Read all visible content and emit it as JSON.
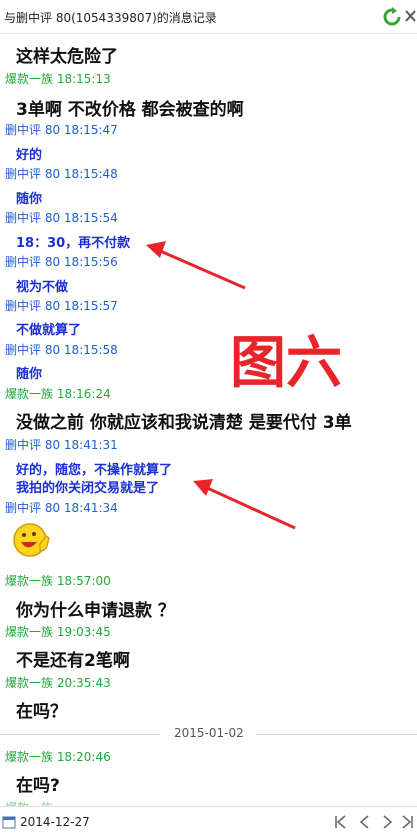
{
  "window": {
    "title": "与删中评 80(1054339807)的消息记录"
  },
  "messages": [
    {
      "type": "text",
      "body": "这样太危险了"
    },
    {
      "type": "header",
      "sender": "爆款一族",
      "time": "18:15:13"
    },
    {
      "type": "text",
      "body": "3单啊  不改价格 都会被查的啊"
    },
    {
      "type": "header",
      "sender": "删中评 80",
      "time": "18:15:47"
    },
    {
      "type": "text",
      "body": "好的"
    },
    {
      "type": "header",
      "sender": "删中评 80",
      "time": "18:15:48"
    },
    {
      "type": "text",
      "body": "随你"
    },
    {
      "type": "header",
      "sender": "删中评 80",
      "time": "18:15:54"
    },
    {
      "type": "text",
      "body": "18：30，再不付款"
    },
    {
      "type": "header",
      "sender": "删中评 80",
      "time": "18:15:56"
    },
    {
      "type": "text",
      "body": "视为不做"
    },
    {
      "type": "header",
      "sender": "删中评 80",
      "time": "18:15:57"
    },
    {
      "type": "text",
      "body": "不做就算了"
    },
    {
      "type": "header",
      "sender": "删中评 80",
      "time": "18:15:58"
    },
    {
      "type": "text",
      "body": "随你"
    },
    {
      "type": "header",
      "sender": "爆款一族",
      "time": "18:16:24"
    },
    {
      "type": "text",
      "body": "没做之前 你就应该和我说清楚  是要代付  3单"
    },
    {
      "type": "header",
      "sender": "删中评 80",
      "time": "18:41:31"
    },
    {
      "type": "text",
      "body": "好的，随您，不操作就算了"
    },
    {
      "type": "text",
      "body": "我拍的你关闭交易就是了"
    },
    {
      "type": "header",
      "sender": "删中评 80",
      "time": "18:41:34"
    },
    {
      "type": "emoji",
      "icon": "thumbs-up-smiley-emoji"
    },
    {
      "type": "header",
      "sender": "爆款一族",
      "time": "18:57:00"
    },
    {
      "type": "text",
      "body": "你为什么申请退款  ？"
    },
    {
      "type": "header",
      "sender": "爆款一族",
      "time": "19:03:45"
    },
    {
      "type": "text",
      "body": "不是还有2笔啊"
    },
    {
      "type": "header",
      "sender": "爆款一族",
      "time": "20:35:43"
    },
    {
      "type": "text",
      "body": "在吗？"
    },
    {
      "type": "date",
      "label": "2015-01-02"
    },
    {
      "type": "header",
      "sender": "爆款一族",
      "time": "18:20:46"
    },
    {
      "type": "text",
      "body": "在吗?"
    }
  ],
  "watermark": {
    "text": "图六",
    "color": "#e8252b"
  },
  "colors": {
    "buyer": "#21a83b",
    "seller": "#1f5fd1",
    "seller_text": "#1a2fd6",
    "arrow": "#e8252b"
  },
  "statusbar": {
    "date": "2014-12-27"
  }
}
